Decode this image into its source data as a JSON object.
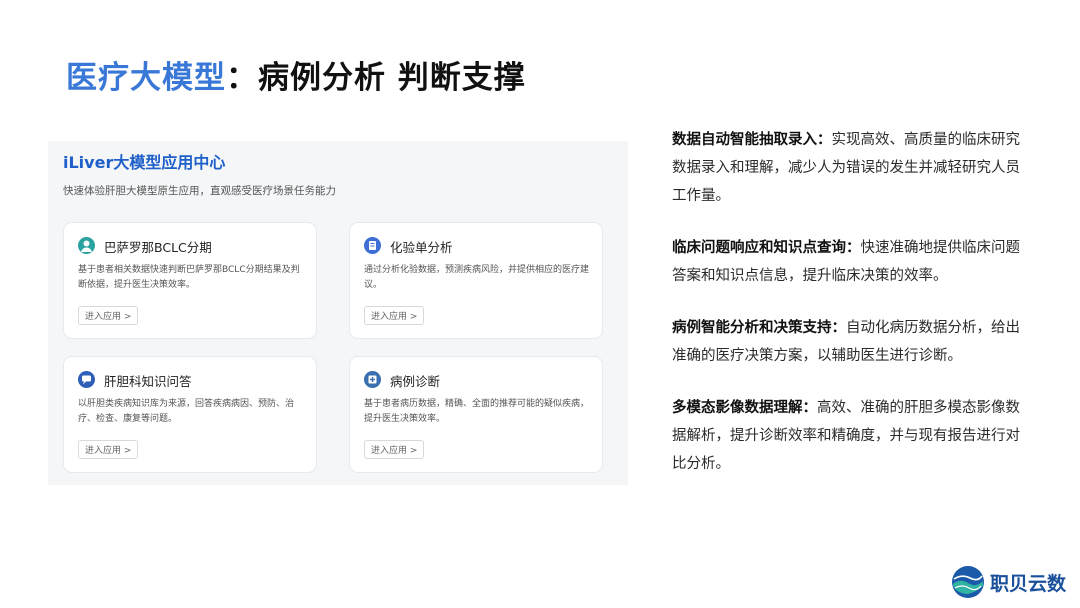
{
  "slide": {
    "title_part1": "医疗大模型",
    "title_sep": "：",
    "title_part2": "病例分析 判断支撑"
  },
  "screenshot": {
    "header": "iLiver大模型应用中心",
    "subtitle": "快速体验肝胆大模型原生应用，直观感受医疗场景任务能力",
    "cards": [
      {
        "name": "巴萨罗那BCLC分期",
        "desc": "基于患者相关数据快速判断巴萨罗那BCLC分期结果及判断依据，提升医生决策效率。",
        "button": "进入应用 >",
        "icon": "avatar-icon",
        "icon_color": "#2aa3a0"
      },
      {
        "name": "化验单分析",
        "desc": "通过分析化验数据，预测疾病风险，并提供相应的医疗建议。",
        "button": "进入应用 >",
        "icon": "report-icon",
        "icon_color": "#3d6fd6"
      },
      {
        "name": "肝胆科知识问答",
        "desc": "以肝胆类疾病知识库为来源，回答疾病病因、预防、治疗、检查、康复等问题。",
        "button": "进入应用 >",
        "icon": "chat-icon",
        "icon_color": "#2f5fb8"
      },
      {
        "name": "病例诊断",
        "desc": "基于患者病历数据，精确、全面的推荐可能的疑似疾病，提升医生决策效率。",
        "button": "进入应用 >",
        "icon": "diagnosis-icon",
        "icon_color": "#3a6fb0"
      }
    ]
  },
  "features": [
    {
      "label": "数据自动智能抽取录入：",
      "text": "实现高效、高质量的临床研究数据录入和理解，减少人为错误的发生并减轻研究人员工作量。"
    },
    {
      "label": "临床问题响应和知识点查询：",
      "text": "快速准确地提供临床问题答案和知识点信息，提升临床决策的效率。"
    },
    {
      "label": "病例智能分析和决策支持：",
      "text": "自动化病历数据分析，给出准确的医疗决策方案，以辅助医生进行诊断。"
    },
    {
      "label": "多模态影像数据理解：",
      "text": "高效、准确的肝胆多模态影像数据解析，提升诊断效率和精确度，并与现有报告进行对比分析。"
    }
  ],
  "logo": {
    "text": "职贝云数",
    "icon": "globe-logo-icon"
  },
  "colors": {
    "title_accent": "#3a78d8",
    "header_blue": "#1f5fc9",
    "panel_bg": "#f4f6f8"
  }
}
